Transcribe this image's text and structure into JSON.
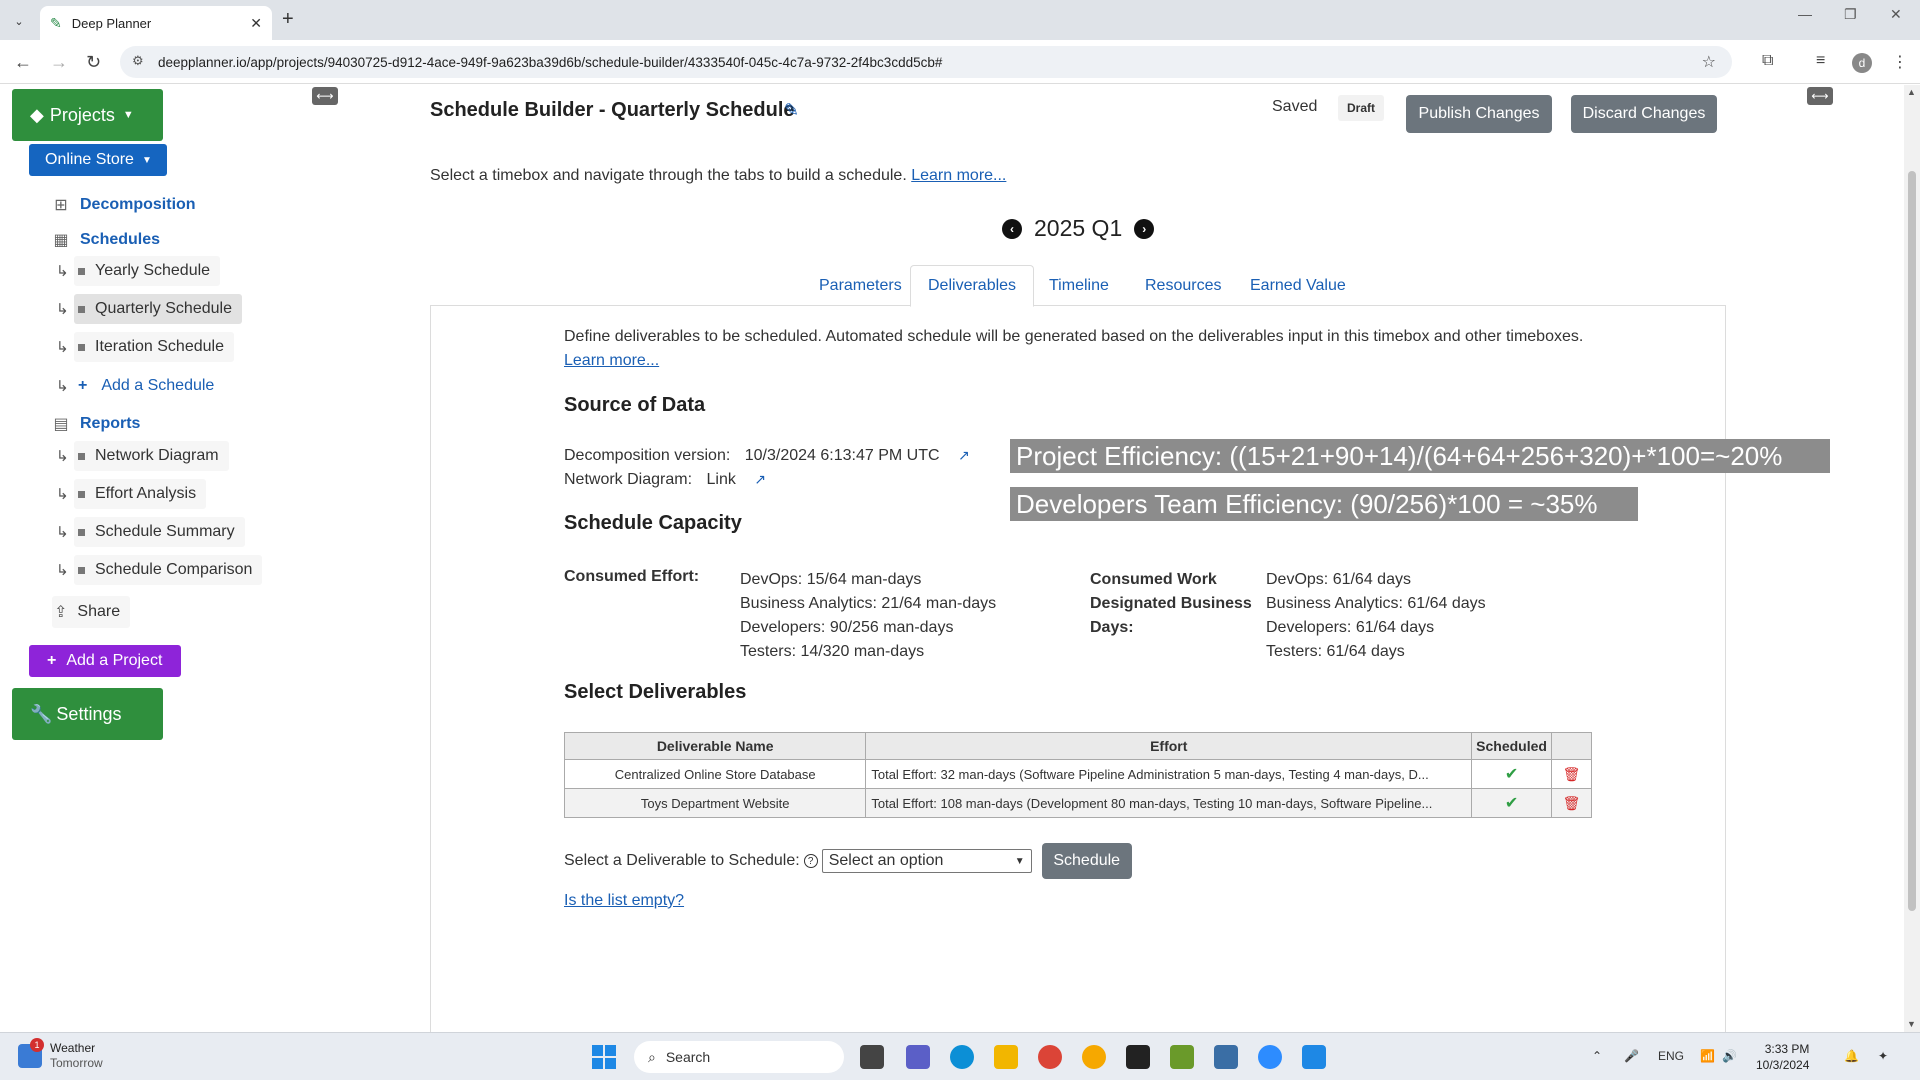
{
  "browser": {
    "tab_title": "Deep Planner",
    "url": "deepplanner.io/app/projects/94030725-d912-4ace-949f-9a623ba39d6b/schedule-builder/4333540f-045c-4c7a-9732-2f4bc3cdd5cb#",
    "avatar_letter": "d"
  },
  "sidebar": {
    "projects_label": "Projects",
    "project_select": "Online Store",
    "decomposition": "Decomposition",
    "schedules": "Schedules",
    "schedule_items": [
      "Yearly Schedule",
      "Quarterly Schedule",
      "Iteration Schedule"
    ],
    "add_schedule": "Add a Schedule",
    "reports": "Reports",
    "report_items": [
      "Network Diagram",
      "Effort Analysis",
      "Schedule Summary",
      "Schedule Comparison"
    ],
    "share": "Share",
    "add_project": "Add a Project",
    "settings": "Settings"
  },
  "header": {
    "title": "Schedule Builder - Quarterly Schedule",
    "saved": "Saved",
    "draft": "Draft",
    "publish": "Publish Changes",
    "discard": "Discard Changes",
    "intro": "Select a timebox and navigate through the tabs to build a schedule.",
    "learn_more": "Learn more...",
    "period": "2025 Q1"
  },
  "tabs": [
    "Parameters",
    "Deliverables",
    "Timeline",
    "Resources",
    "Earned Value"
  ],
  "deliverables": {
    "description": "Define deliverables to be scheduled. Automated schedule will be generated based on the deliverables input in this timebox and other timeboxes.",
    "learn_more": "Learn more...",
    "source_heading": "Source of Data",
    "decomp_label": "Decomposition version:",
    "decomp_value": "10/3/2024 6:13:47 PM UTC",
    "network_label": "Network Diagram:",
    "network_value": "Link",
    "capacity_heading": "Schedule Capacity",
    "consumed_effort_label": "Consumed Effort:",
    "consumed_effort": [
      "DevOps: 15/64 man-days",
      "Business Analytics: 21/64 man-days",
      "Developers: 90/256 man-days",
      "Testers: 14/320 man-days"
    ],
    "consumed_work_label_1": "Consumed Work",
    "consumed_work_label_2": "Designated Business",
    "consumed_work_label_3": "Days:",
    "consumed_work": [
      "DevOps: 61/64 days",
      "Business Analytics: 61/64 days",
      "Developers: 61/64 days",
      "Testers: 61/64 days"
    ],
    "select_heading": "Select Deliverables",
    "table": {
      "headers": [
        "Deliverable Name",
        "Effort",
        "Scheduled",
        ""
      ],
      "rows": [
        {
          "name": "Centralized Online Store Database",
          "effort": "Total Effort: 32 man-days (Software Pipeline Administration 5 man-days, Testing 4 man-days, D..."
        },
        {
          "name": "Toys Department Website",
          "effort": "Total Effort: 108 man-days (Development 80 man-days, Testing 10 man-days, Software Pipeline..."
        }
      ]
    },
    "select_label": "Select a Deliverable to Schedule:",
    "select_value": "Select an option",
    "schedule_button": "Schedule",
    "empty_link": "Is the list empty?"
  },
  "overlays": {
    "project_efficiency": "Project Efficiency: ((15+21+90+14)/(64+64+256+320)+*100=~20%",
    "team_efficiency": "Developers Team Efficiency: (90/256)*100 = ~35%"
  },
  "taskbar": {
    "weather_title": "Weather",
    "weather_sub": "Tomorrow",
    "weather_badge": "1",
    "search": "Search",
    "lang": "ENG",
    "time": "3:33 PM",
    "date": "10/3/2024"
  }
}
